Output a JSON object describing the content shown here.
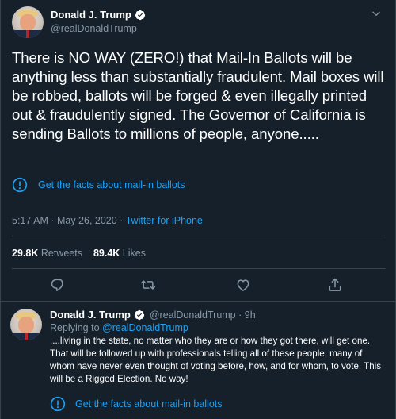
{
  "main_tweet": {
    "display_name": "Donald J. Trump",
    "handle": "@realDonaldTrump",
    "text": "There is NO WAY (ZERO!) that Mail-In Ballots will be anything less than substantially fraudulent. Mail boxes will be robbed, ballots will be forged & even illegally printed out & fraudulently signed. The Governor of California is sending Ballots to millions of people, anyone.....",
    "notice": "Get the facts about mail-in ballots",
    "timestamp": "5:17 AM · May 26, 2020 · ",
    "source": "Twitter for iPhone",
    "retweets_count": "29.8K",
    "retweets_label": "Retweets",
    "likes_count": "89.4K",
    "likes_label": "Likes",
    "icons": {
      "verified": "verified-badge-icon",
      "menu": "chevron-down-icon",
      "info": "info-icon",
      "reply": "reply-bubble-icon",
      "retweet": "retweet-icon",
      "like": "heart-icon",
      "share": "share-icon"
    }
  },
  "reply_tweet": {
    "display_name": "Donald J. Trump",
    "handle_time": "@realDonaldTrump · 9h",
    "replying_prefix": "Replying to ",
    "replying_to": "@realDonaldTrump",
    "text": "....living in the state, no matter who they are or how they got there, will get one. That will be followed up with professionals telling all of these people, many of whom have never even thought of voting before, how, and for whom, to vote. This will be a Rigged Election. No way!",
    "notice": "Get the facts about mail-in ballots"
  },
  "colors": {
    "background": "#15202b",
    "border": "#38444d",
    "accent": "#1da1f2",
    "secondary_text": "#8899a6",
    "primary_text": "#ffffff"
  }
}
